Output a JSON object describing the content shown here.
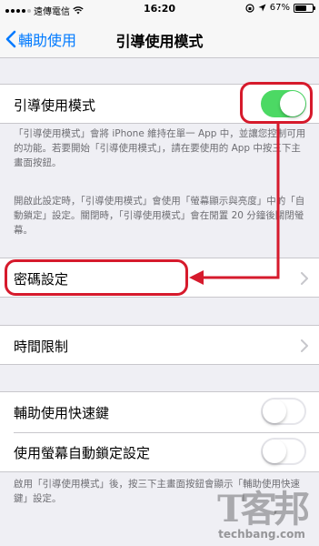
{
  "status_bar": {
    "carrier": "遠傳電信",
    "time": "16:20",
    "battery_percent": "67%",
    "battery_level": 0.67
  },
  "nav": {
    "back_label": "輔助使用",
    "title": "引導使用模式"
  },
  "guided_access": {
    "label": "引導使用模式",
    "enabled": true
  },
  "footnote_1": "「引導使用模式」會將 iPhone 維持在單一 App 中，並讓您控制可用的功能。若要開始「引導使用模式」，請在要使用的 App 中按三下主畫面按鈕。",
  "footnote_2": "開啟此設定時，「引導使用模式」會使用「螢幕顯示與亮度」中的「自動鎖定」設定。關閉時，「引導使用模式」會在閒置 20 分鐘後關閉螢幕。",
  "passcode_settings": {
    "label": "密碼設定"
  },
  "time_limits": {
    "label": "時間限制"
  },
  "accessibility_shortcut": {
    "label": "輔助使用快速鍵",
    "enabled": false
  },
  "mirror_auto_lock": {
    "label": "使用螢幕自動鎖定設定",
    "enabled": false
  },
  "footnote_3": "啟用「引導使用模式」後，按三下主畫面按鈕會顯示「輔助使用快速鍵」設定。",
  "watermark": {
    "logo": "T客邦",
    "text": "techbang.com"
  },
  "colors": {
    "accent": "#007aff",
    "toggle_on": "#4cd964",
    "annotation": "#d61a2c"
  }
}
